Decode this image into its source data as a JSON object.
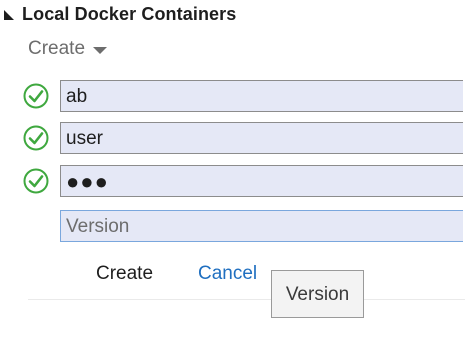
{
  "section": {
    "title": "Local Docker Containers",
    "expanded": true
  },
  "create_dropdown": {
    "label": "Create"
  },
  "fields": [
    {
      "value": "ab",
      "valid": true
    },
    {
      "value": "user",
      "valid": true
    },
    {
      "value": "●●●",
      "valid": true,
      "masked": true
    },
    {
      "value": "",
      "placeholder": "Version",
      "valid": null,
      "focused": true
    }
  ],
  "actions": {
    "create_label": "Create",
    "cancel_label": "Cancel"
  },
  "tooltip": {
    "text": "Version"
  },
  "colors": {
    "check": "#3fa83f",
    "link": "#1f6fc0",
    "field_bg": "#e5e8f6"
  }
}
